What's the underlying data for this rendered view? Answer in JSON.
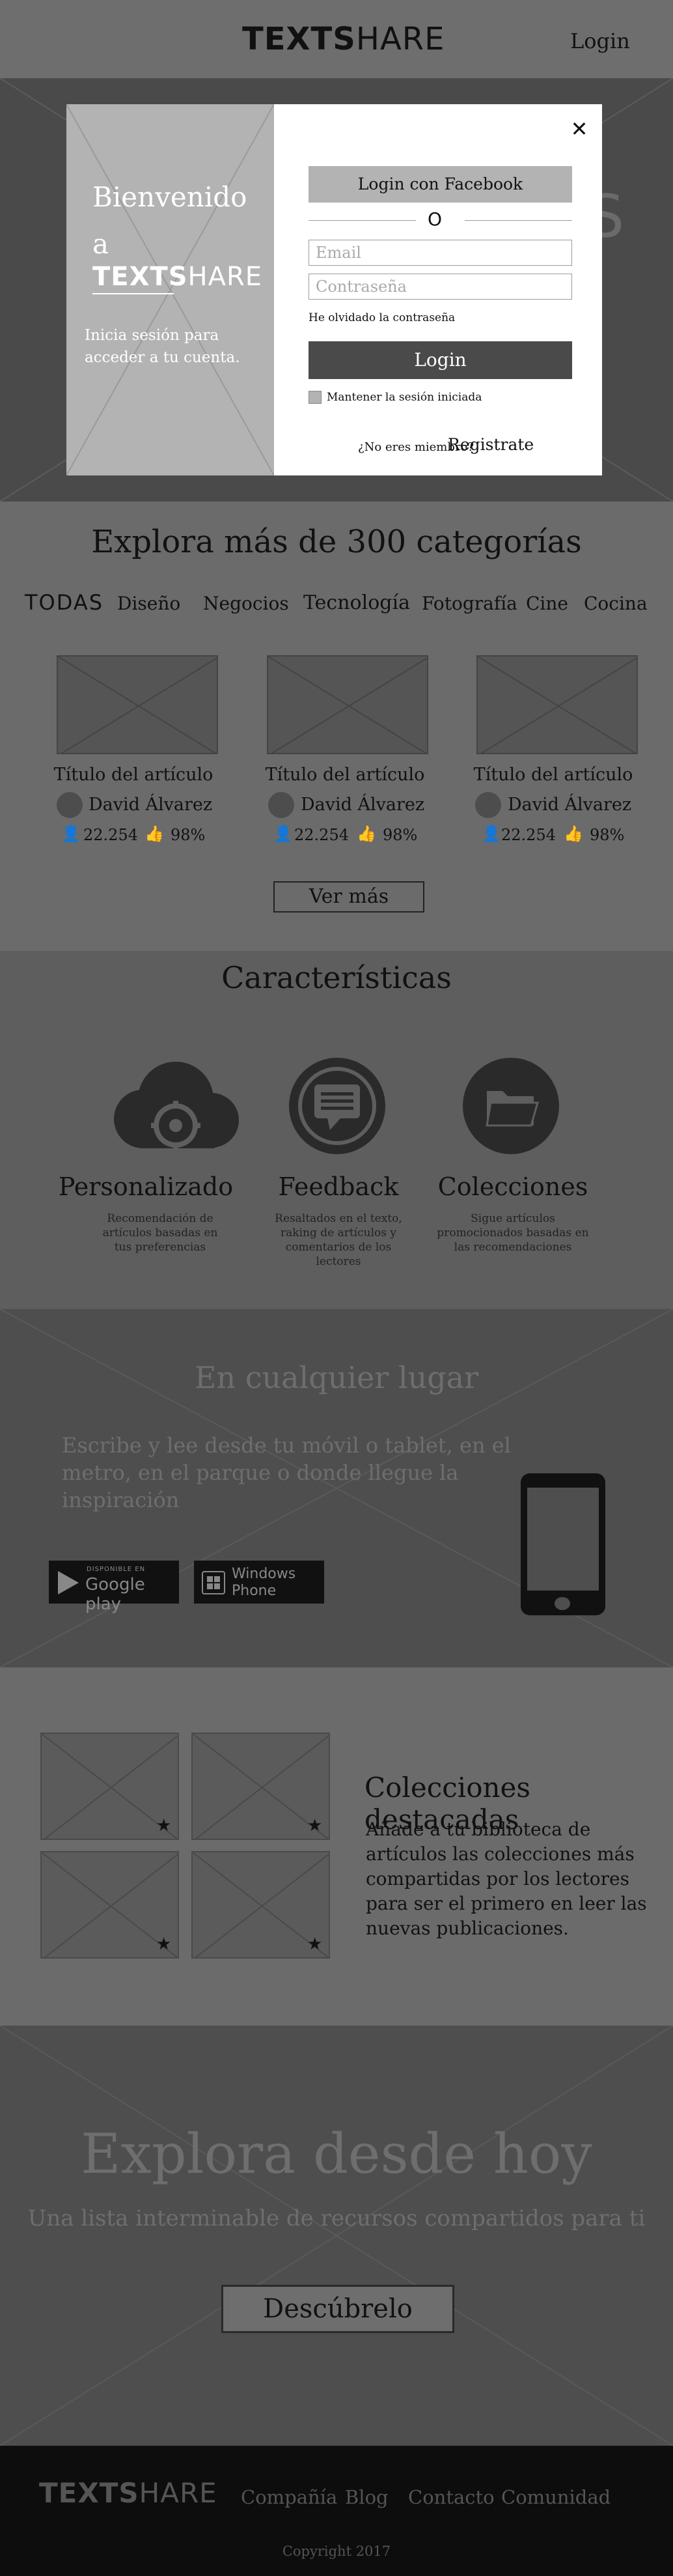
{
  "header": {
    "logo_bold": "TEXTS",
    "logo_light": "HARE",
    "login": "Login"
  },
  "hero": {
    "ghost_text": "S"
  },
  "modal": {
    "welcome_line1": "Bienvenido",
    "welcome_a": "a",
    "subtitle": "Inicia sesión para acceder a tu cuenta.",
    "close": "✕",
    "facebook": "Login con Facebook",
    "or": "O",
    "email_placeholder": "Email",
    "password_placeholder": "Contraseña",
    "forgot": "He olvidado la contraseña",
    "login": "Login",
    "remember": "Mantener la sesión iniciada",
    "no_member": "¿No eres miembro?",
    "register": "Registrate"
  },
  "categories": {
    "title": "Explora más de 300 categorías",
    "tabs": [
      "TODAS",
      "Diseño",
      "Negocios",
      "Tecnología",
      "Fotografía",
      "Cine",
      "Cocina"
    ],
    "cards": [
      {
        "title": "Título del artículo",
        "author": "David Álvarez",
        "views": "22.254",
        "likes": "98%"
      },
      {
        "title": "Título del artículo",
        "author": "David Álvarez",
        "views": "22.254",
        "likes": "98%"
      },
      {
        "title": "Título del artículo",
        "author": "David Álvarez",
        "views": "22.254",
        "likes": "98%"
      }
    ],
    "see_more": "Ver más"
  },
  "features": {
    "title": "Características",
    "items": [
      {
        "name": "Personalizado",
        "desc": "Recomendación de artículos basadas en tus preferencias"
      },
      {
        "name": "Feedback",
        "desc": "Resaltados en el texto, raking de artículos y comentarios de los lectores"
      },
      {
        "name": "Colecciones",
        "desc": "Sigue artículos promocionados basadas en las recomendaciones"
      }
    ]
  },
  "anywhere": {
    "title": "En cualquier lugar",
    "subtitle": "Escribe y lee desde tu móvil o tablet, en el metro, en el parque o donde llegue la inspiración",
    "gplay_small": "DISPONIBLE EN",
    "gplay_big": "Google play",
    "wphone_line1": "Windows",
    "wphone_line2": "Phone"
  },
  "collections": {
    "title": "Colecciones destacadas",
    "desc": "Añade a tu biblioteca de artículos las colecciones más compartidas por los lectores para ser el primero en leer las nuevas publicaciones.",
    "star": "★"
  },
  "explore": {
    "title": "Explora desde hoy",
    "subtitle": "Una lista interminable de recursos compartidos para ti",
    "button": "Descúbrelo"
  },
  "footer": {
    "logo_bold": "TEXTS",
    "logo_light": "HARE",
    "links": [
      "Compañía",
      "Blog",
      "Contacto",
      "Comunidad"
    ],
    "copyright": "Copyright 2017"
  },
  "colors": {
    "dark": "#4a4a4a",
    "mid": "#6b6b6b",
    "light": "#b3b3b3",
    "footer": "#0d0d0d"
  }
}
